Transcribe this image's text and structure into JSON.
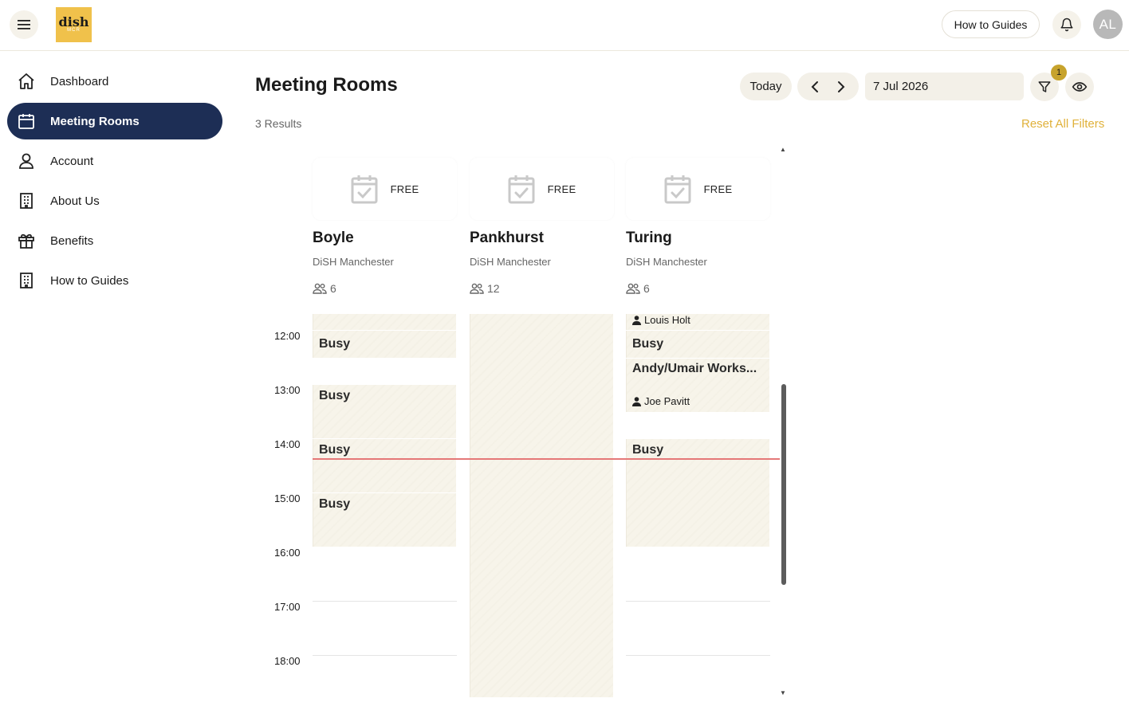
{
  "header": {
    "logo_text": "dish",
    "logo_sub": "MCR",
    "how_to_guides": "How to Guides",
    "avatar_initials": "AL"
  },
  "sidebar": {
    "items": [
      {
        "label": "Dashboard",
        "icon": "home-icon",
        "active": false
      },
      {
        "label": "Meeting Rooms",
        "icon": "calendar-icon",
        "active": true
      },
      {
        "label": "Account",
        "icon": "user-icon",
        "active": false
      },
      {
        "label": "About Us",
        "icon": "building-icon",
        "active": false
      },
      {
        "label": "Benefits",
        "icon": "gift-icon",
        "active": false
      },
      {
        "label": "How to Guides",
        "icon": "building-icon",
        "active": false
      }
    ]
  },
  "main": {
    "title": "Meeting Rooms",
    "results": "3 Results",
    "reset_filters": "Reset All Filters",
    "today": "Today",
    "date_value": "7 Jul 2026",
    "filter_badge": "1"
  },
  "rooms": [
    {
      "name": "Boyle",
      "location": "DiSH Manchester",
      "capacity": "6",
      "status": "FREE"
    },
    {
      "name": "Pankhurst",
      "location": "DiSH Manchester",
      "capacity": "12",
      "status": "FREE"
    },
    {
      "name": "Turing",
      "location": "DiSH Manchester",
      "capacity": "6",
      "status": "FREE"
    }
  ],
  "times": [
    "12:00",
    "13:00",
    "14:00",
    "15:00",
    "16:00",
    "17:00",
    "18:00"
  ],
  "events": {
    "boyle": [
      {
        "label": "Busy"
      },
      {
        "label": "Busy"
      },
      {
        "label": "Busy"
      },
      {
        "label": "Busy"
      }
    ],
    "turing": [
      {
        "organizer": "Louis Holt"
      },
      {
        "label": "Busy"
      },
      {
        "label": "Andy/Umair Works...",
        "organizer": "Joe Pavitt"
      },
      {
        "label": "Busy"
      }
    ]
  },
  "colors": {
    "accent": "#1d2e55",
    "brand": "#f0c14b",
    "link": "#e0b13a",
    "now_line": "#e57878"
  }
}
